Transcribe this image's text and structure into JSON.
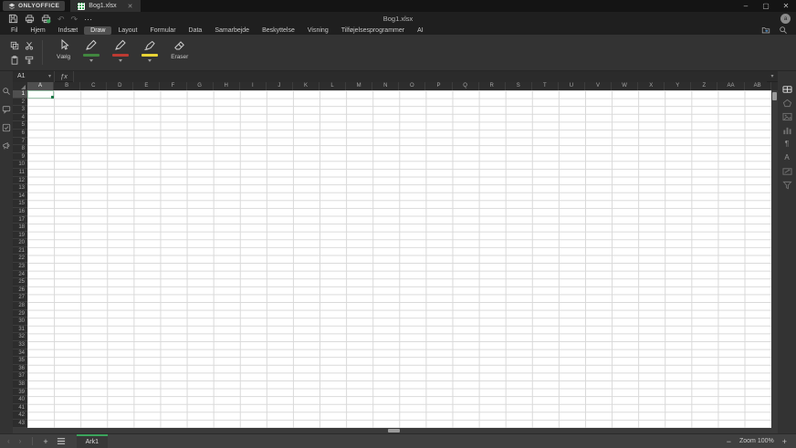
{
  "brand": "ONLYOFFICE",
  "window": {
    "doc_tab_label": "Bog1.xlsx",
    "title": "Bog1.xlsx"
  },
  "icons": {
    "minimize": "–",
    "maximize": "▢",
    "close": "✕",
    "tab_close": "✕",
    "undo": "↶",
    "redo": "↷",
    "more": "⋯",
    "cut": "✂",
    "nav_left": "‹",
    "nav_right": "›",
    "name_box_chevron": "▾",
    "formula_expand": "▾",
    "pivot": "¶",
    "text_art": "A"
  },
  "user_initial": "a",
  "menu": {
    "items": [
      "Fil",
      "Hjem",
      "Indsæt",
      "Draw",
      "Layout",
      "Formular",
      "Data",
      "Samarbejde",
      "Beskyttelse",
      "Visning",
      "Tilføjelsesprogrammer",
      "AI"
    ],
    "active": "Draw"
  },
  "toolbar": {
    "select_label": "Vælg",
    "eraser_label": "Eraser",
    "pen1_color": "#41873f",
    "pen2_color": "#bd3a32",
    "highlighter_color": "#e8d335"
  },
  "formula_bar": {
    "cell_ref": "A1",
    "fx_label": "ƒx",
    "formula_value": ""
  },
  "grid": {
    "columns": [
      "A",
      "B",
      "C",
      "D",
      "E",
      "F",
      "G",
      "H",
      "I",
      "J",
      "K",
      "L",
      "M",
      "N",
      "O",
      "P",
      "Q",
      "R",
      "S",
      "T",
      "U",
      "V",
      "W",
      "X",
      "Y",
      "Z",
      "AA",
      "AB"
    ],
    "rows": [
      1,
      2,
      3,
      4,
      5,
      6,
      7,
      8,
      9,
      10,
      11,
      12,
      13,
      14,
      15,
      16,
      17,
      18,
      19,
      20,
      21,
      22,
      23,
      24,
      25,
      26,
      27,
      28,
      29,
      30,
      31,
      32,
      33,
      34,
      35,
      36,
      37,
      38,
      39,
      40,
      41,
      42,
      43
    ],
    "selected_cell": "A1",
    "selected_col": "A",
    "selected_row": 1,
    "selection_border_color": "#9ec4ad",
    "accent_green": "#3ca45c"
  },
  "sheet_bar": {
    "active_sheet": "Ark1"
  },
  "status_bar": {
    "zoom_minus": "−",
    "zoom_label": "Zoom 100%",
    "zoom_plus": "+"
  }
}
